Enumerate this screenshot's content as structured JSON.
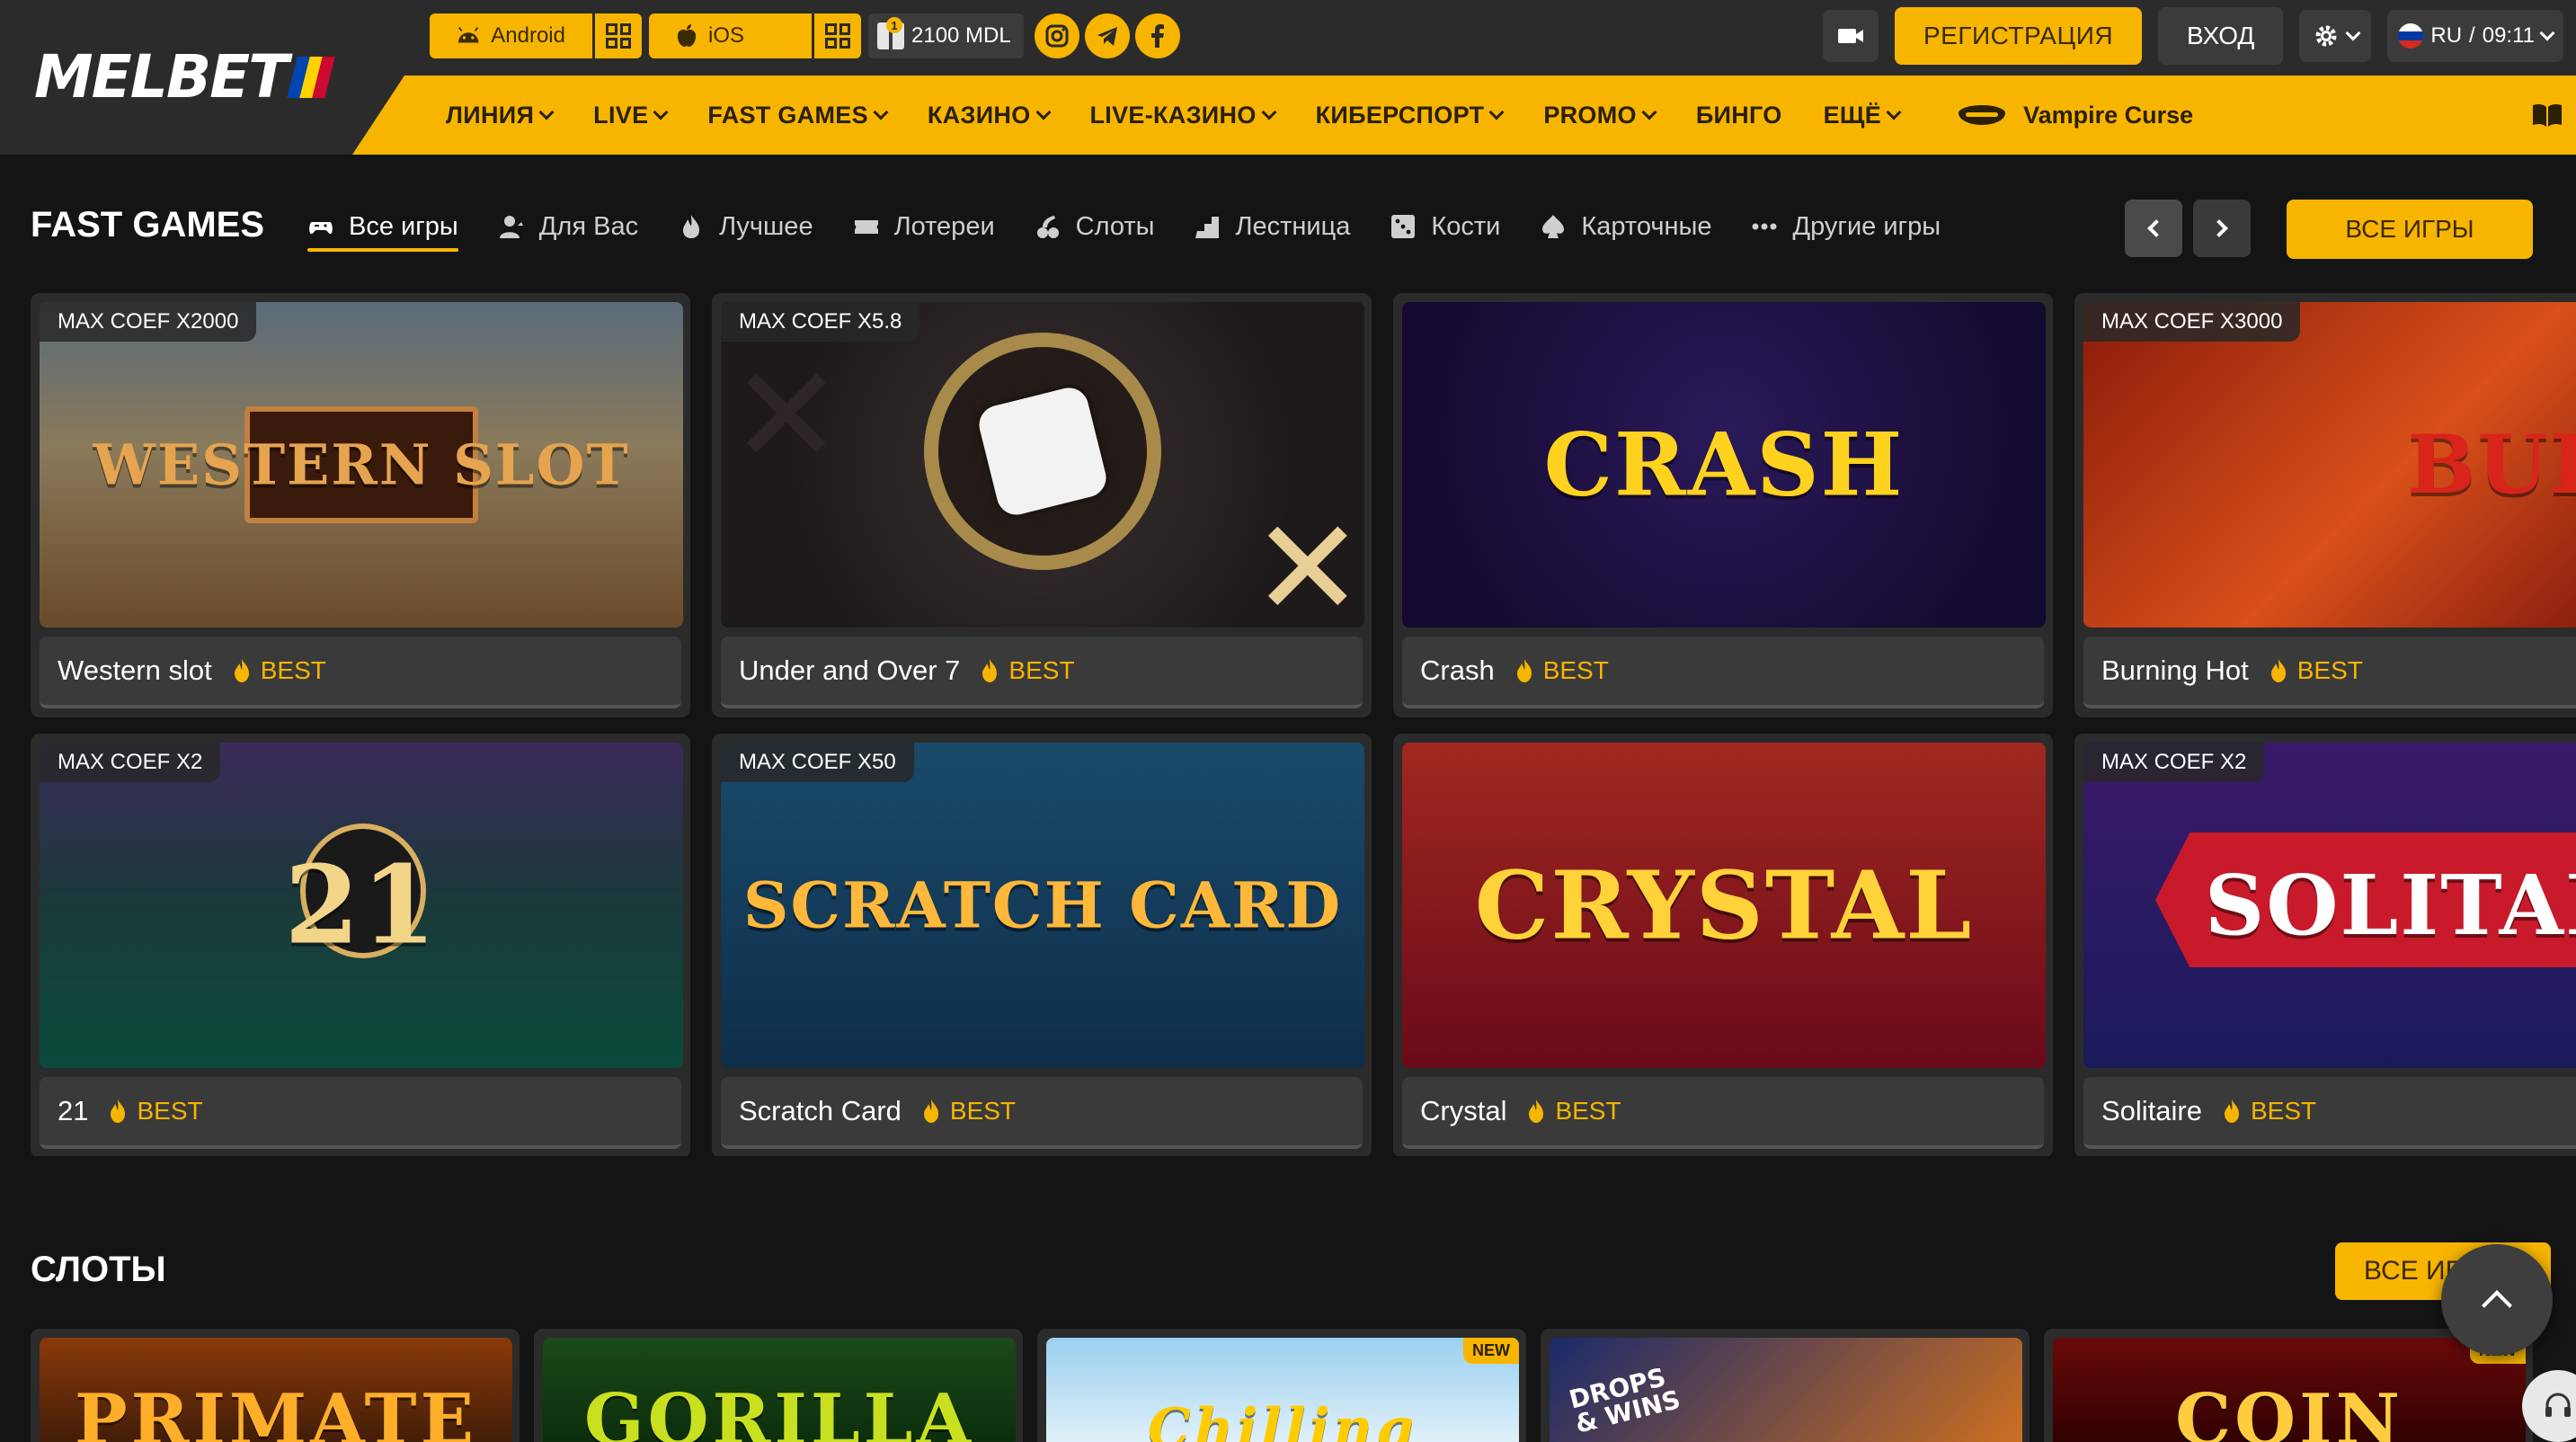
{
  "header": {
    "logo_text": "MELBET",
    "flag_colors": [
      "#0046ae",
      "#ffd200",
      "#cc092f"
    ],
    "apps": [
      {
        "label": "Android",
        "icon": "android-icon"
      },
      {
        "label": "iOS",
        "icon": "apple-icon"
      }
    ],
    "bonus_label": "2100 MDL",
    "bonus_badge": "1",
    "socials": [
      "instagram-icon",
      "telegram-icon",
      "facebook-icon"
    ],
    "register_label": "РЕГИСТРАЦИЯ",
    "login_label": "ВХОД",
    "lang_label": "RU",
    "time_label": "09:11",
    "lang_separator": "/"
  },
  "nav": {
    "items": [
      {
        "label": "ЛИНИЯ",
        "has_dropdown": true
      },
      {
        "label": "LIVE",
        "has_dropdown": true
      },
      {
        "label": "FAST GAMES",
        "has_dropdown": true
      },
      {
        "label": "КАЗИНО",
        "has_dropdown": true
      },
      {
        "label": "LIVE-КАЗИНО",
        "has_dropdown": true
      },
      {
        "label": "КИБЕРСПОРТ",
        "has_dropdown": true
      },
      {
        "label": "PROMO",
        "has_dropdown": true
      },
      {
        "label": "БИНГО",
        "has_dropdown": false
      },
      {
        "label": "ЕЩЁ",
        "has_dropdown": true
      }
    ],
    "promo_label": "Vampire Curse"
  },
  "fast_games": {
    "title": "FAST GAMES",
    "tabs": [
      {
        "label": "Все игры",
        "active": true
      },
      {
        "label": "Для Вас",
        "active": false
      },
      {
        "label": "Лучшее",
        "active": false
      },
      {
        "label": "Лотереи",
        "active": false
      },
      {
        "label": "Слоты",
        "active": false
      },
      {
        "label": "Лестница",
        "active": false
      },
      {
        "label": "Кости",
        "active": false
      },
      {
        "label": "Карточные",
        "active": false
      },
      {
        "label": "Другие игры",
        "active": false
      }
    ],
    "all_games_label": "ВСЕ ИГРЫ",
    "best_label": "BEST",
    "games": [
      {
        "name": "Western slot",
        "coef": "MAX COEF X2000",
        "art_text": "WESTERN SLOT"
      },
      {
        "name": "Under and Over 7",
        "coef": "MAX COEF X5.8",
        "art_text": ""
      },
      {
        "name": "Crash",
        "coef": "",
        "art_text": "CRASH"
      },
      {
        "name": "Burning Hot",
        "coef": "MAX COEF X3000",
        "art_text": "BUR H"
      },
      {
        "name": "21",
        "coef": "MAX COEF X2",
        "art_text": "21"
      },
      {
        "name": "Scratch Card",
        "coef": "MAX COEF X50",
        "art_text": "SCRATCH CARD"
      },
      {
        "name": "Crystal",
        "coef": "",
        "art_text": "CRYSTAL"
      },
      {
        "name": "Solitaire",
        "coef": "MAX COEF X2",
        "art_text": "SOLITAI"
      }
    ]
  },
  "slots": {
    "title": "СЛОТЫ",
    "all_games_label": "ВСЕ ИГРЫ",
    "items": [
      {
        "art_text": "PRIMATE",
        "new": false
      },
      {
        "art_text": "GORILLA",
        "new": false
      },
      {
        "art_text": "Chilling",
        "new": true,
        "new_label": "NEW"
      },
      {
        "art_text": "DROPS & WINS",
        "new": false
      },
      {
        "art_text": "COIN",
        "new": true,
        "new_label": "NEW"
      }
    ]
  },
  "colors": {
    "accent": "#f7b500",
    "header_bg": "#2b2b2b",
    "page_bg": "#141414"
  }
}
